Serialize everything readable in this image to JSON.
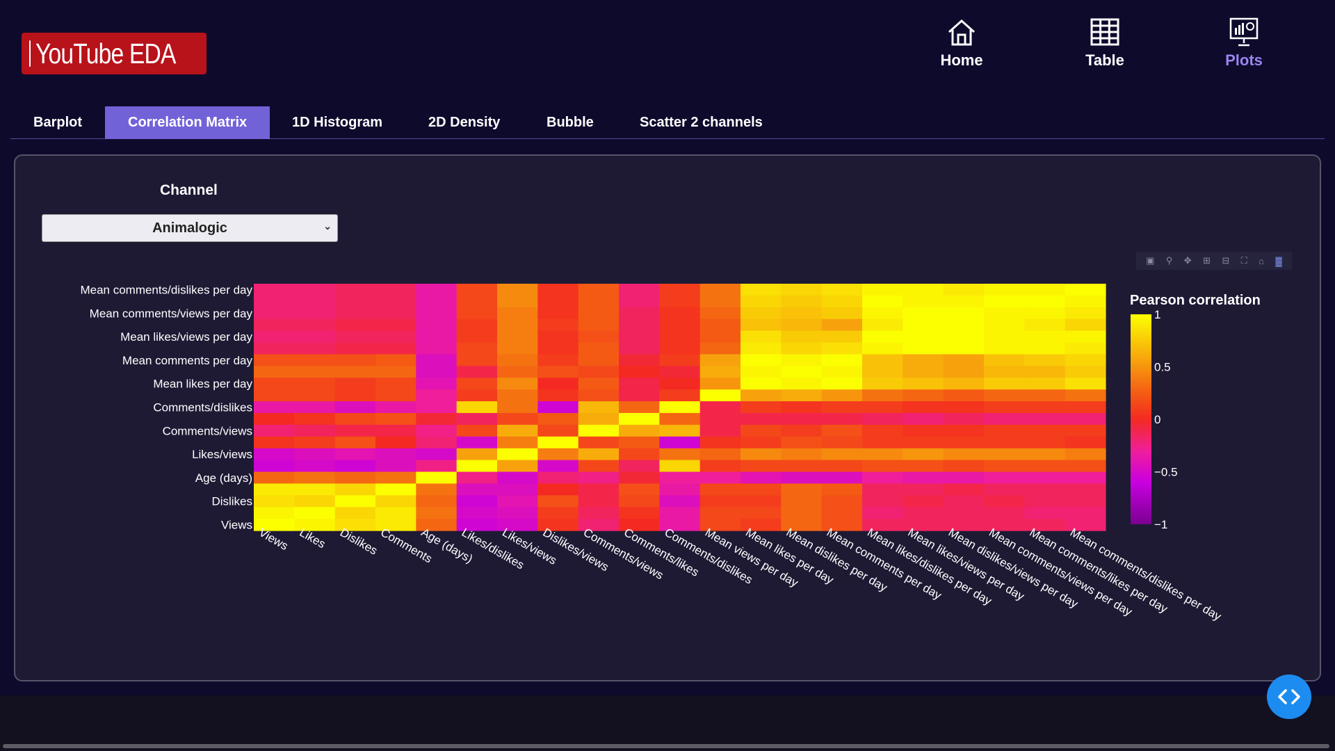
{
  "app": {
    "logo_text": "YouTube EDA"
  },
  "nav": {
    "items": [
      {
        "label": "Home",
        "icon": "home-icon",
        "color": "#ffffff"
      },
      {
        "label": "Table",
        "icon": "table-icon",
        "color": "#ffffff"
      },
      {
        "label": "Plots",
        "icon": "plots-icon",
        "color": "#9b84f0"
      }
    ]
  },
  "tabs": [
    {
      "label": "Barplot",
      "active": false
    },
    {
      "label": "Correlation Matrix",
      "active": true
    },
    {
      "label": "1D Histogram",
      "active": false
    },
    {
      "label": "2D Density",
      "active": false
    },
    {
      "label": "Bubble",
      "active": false
    },
    {
      "label": "Scatter 2 channels",
      "active": false
    }
  ],
  "filter": {
    "label": "Channel",
    "selected": "Animalogic"
  },
  "modebar": {
    "icons": [
      "camera-icon",
      "zoom-icon",
      "pan-icon",
      "zoom-in-icon",
      "zoom-out-icon",
      "autoscale-icon",
      "reset-axes-icon",
      "plotly-logo-icon"
    ]
  },
  "chart_data": {
    "type": "heatmap",
    "colorbar_title": "Pearson correlation",
    "colorscale": "plasma-like (purple-magenta-red-orange-yellow)",
    "zlim": [
      -1,
      1
    ],
    "colorbar_ticks": [
      "1",
      "0.5",
      "0",
      "−0.5",
      "−1"
    ],
    "colorbar_tick_values": [
      1,
      0.5,
      0,
      -0.5,
      -1
    ],
    "x_labels": [
      "Views",
      "Likes",
      "Dislikes",
      "Comments",
      "Age (days)",
      "Likes/dislikes",
      "Likes/views",
      "Dislikes/views",
      "Comments/views",
      "Comments/likes",
      "Comments/dislikes",
      "Mean views per day",
      "Mean likes per day",
      "Mean dislikes per day",
      "Mean comments per day",
      "Mean likes/dislikes per day",
      "Mean likes/views per day",
      "Mean dislikes/views per day",
      "Mean comments/views per day",
      "Mean comments/likes per day",
      "Mean comments/dislikes per day"
    ],
    "y_tick_labels": [
      "Mean comments/dislikes per day",
      "Mean comments/views per day",
      "Mean likes/views per day",
      "Mean comments per day",
      "Mean likes per day",
      "Comments/dislikes",
      "Comments/views",
      "Likes/views",
      "Age (days)",
      "Dislikes",
      "Views"
    ],
    "rows_top_to_bottom": [
      "Mean comments/dislikes per day",
      "Mean comments/likes per day",
      "Mean comments/views per day",
      "Mean dislikes/views per day",
      "Mean likes/views per day",
      "Mean likes/dislikes per day",
      "Mean comments per day",
      "Mean dislikes per day",
      "Mean likes per day",
      "Mean views per day",
      "Comments/dislikes",
      "Comments/likes",
      "Comments/views",
      "Dislikes/views",
      "Likes/views",
      "Likes/dislikes",
      "Age (days)",
      "Comments",
      "Dislikes",
      "Likes",
      "Views"
    ],
    "z_top_to_bottom": [
      [
        -0.2,
        -0.2,
        -0.15,
        -0.15,
        -0.35,
        0.15,
        0.45,
        0.05,
        0.25,
        -0.2,
        0.1,
        0.35,
        0.85,
        0.8,
        0.85,
        0.95,
        0.95,
        0.9,
        0.95,
        0.95,
        1.0
      ],
      [
        -0.2,
        -0.2,
        -0.15,
        -0.15,
        -0.35,
        0.15,
        0.45,
        0.05,
        0.25,
        -0.2,
        0.1,
        0.35,
        0.8,
        0.75,
        0.8,
        1.0,
        0.95,
        0.95,
        1.0,
        1.0,
        0.95
      ],
      [
        -0.2,
        -0.2,
        -0.15,
        -0.15,
        -0.35,
        0.15,
        0.4,
        0.05,
        0.25,
        -0.15,
        0.05,
        0.3,
        0.75,
        0.7,
        0.75,
        0.95,
        1.0,
        1.0,
        0.95,
        0.95,
        0.9
      ],
      [
        -0.15,
        -0.15,
        -0.1,
        -0.1,
        -0.35,
        0.1,
        0.4,
        0.1,
        0.25,
        -0.15,
        0.05,
        0.25,
        0.7,
        0.65,
        0.55,
        0.9,
        1.0,
        1.0,
        0.95,
        0.9,
        0.8
      ],
      [
        -0.2,
        -0.2,
        -0.15,
        -0.15,
        -0.35,
        0.1,
        0.4,
        0.05,
        0.2,
        -0.15,
        0.05,
        0.25,
        0.85,
        0.75,
        0.75,
        1.0,
        1.0,
        1.0,
        0.95,
        0.95,
        0.95
      ],
      [
        -0.15,
        -0.15,
        -0.1,
        -0.1,
        -0.35,
        0.15,
        0.4,
        0.05,
        0.25,
        -0.15,
        0.05,
        0.3,
        0.9,
        0.8,
        0.85,
        0.95,
        1.0,
        1.0,
        0.95,
        0.95,
        0.9
      ],
      [
        0.2,
        0.2,
        0.2,
        0.25,
        -0.45,
        0.15,
        0.35,
        0.1,
        0.25,
        -0.05,
        0.1,
        0.55,
        1.0,
        0.95,
        1.0,
        0.7,
        0.6,
        0.55,
        0.7,
        0.75,
        0.8
      ],
      [
        0.3,
        0.3,
        0.3,
        0.3,
        -0.45,
        -0.1,
        0.3,
        0.2,
        0.15,
        0.0,
        -0.05,
        0.6,
        0.95,
        1.0,
        0.95,
        0.7,
        0.6,
        0.55,
        0.65,
        0.65,
        0.75
      ],
      [
        0.15,
        0.15,
        0.1,
        0.15,
        -0.4,
        0.15,
        0.45,
        0.0,
        0.25,
        -0.1,
        0.0,
        0.5,
        1.0,
        0.95,
        1.0,
        0.75,
        0.7,
        0.65,
        0.75,
        0.75,
        0.85
      ],
      [
        0.15,
        0.15,
        0.1,
        0.15,
        -0.3,
        0.1,
        0.35,
        0.05,
        0.2,
        -0.1,
        0.1,
        1.0,
        0.55,
        0.6,
        0.5,
        0.35,
        0.3,
        0.25,
        0.3,
        0.3,
        0.35
      ],
      [
        -0.35,
        -0.35,
        -0.45,
        -0.35,
        -0.3,
        0.8,
        0.35,
        -0.55,
        0.65,
        0.3,
        1.0,
        -0.1,
        0.1,
        0.05,
        0.1,
        0.1,
        0.05,
        0.05,
        0.1,
        0.1,
        0.1
      ],
      [
        0.0,
        0.05,
        0.15,
        0.2,
        -0.05,
        -0.15,
        0.15,
        0.25,
        0.6,
        1.0,
        0.3,
        -0.1,
        -0.1,
        -0.1,
        -0.1,
        -0.15,
        -0.2,
        -0.15,
        -0.2,
        -0.2,
        -0.2
      ],
      [
        -0.2,
        -0.15,
        -0.1,
        -0.1,
        -0.25,
        0.15,
        0.6,
        0.15,
        1.0,
        0.6,
        0.65,
        -0.1,
        0.15,
        0.1,
        0.2,
        0.1,
        0.05,
        0.05,
        0.1,
        0.1,
        0.1
      ],
      [
        0.05,
        0.1,
        0.2,
        0.0,
        -0.2,
        -0.5,
        0.4,
        1.0,
        0.15,
        0.25,
        -0.55,
        0.05,
        0.1,
        0.2,
        0.15,
        0.1,
        0.1,
        0.1,
        0.1,
        0.1,
        0.05
      ],
      [
        -0.5,
        -0.45,
        -0.4,
        -0.45,
        -0.5,
        0.55,
        1.0,
        0.4,
        0.6,
        0.15,
        0.35,
        0.3,
        0.45,
        0.4,
        0.45,
        0.45,
        0.5,
        0.45,
        0.45,
        0.45,
        0.4
      ],
      [
        -0.55,
        -0.5,
        -0.55,
        -0.45,
        -0.25,
        1.0,
        0.55,
        -0.5,
        0.15,
        -0.15,
        0.8,
        0.1,
        0.15,
        0.15,
        0.15,
        0.2,
        0.2,
        0.15,
        0.2,
        0.2,
        0.2
      ],
      [
        0.3,
        0.35,
        0.3,
        0.35,
        1.0,
        -0.25,
        -0.5,
        -0.2,
        -0.25,
        -0.05,
        -0.3,
        -0.3,
        -0.4,
        -0.45,
        -0.45,
        -0.3,
        -0.35,
        -0.35,
        -0.3,
        -0.3,
        -0.3
      ],
      [
        0.9,
        0.9,
        0.8,
        1.0,
        0.35,
        -0.45,
        -0.45,
        0.0,
        -0.1,
        0.2,
        -0.35,
        0.15,
        0.15,
        0.3,
        0.25,
        -0.15,
        -0.15,
        -0.1,
        -0.15,
        -0.15,
        -0.15
      ],
      [
        0.85,
        0.8,
        1.0,
        0.8,
        0.3,
        -0.55,
        -0.4,
        0.2,
        -0.1,
        0.15,
        -0.45,
        0.1,
        0.1,
        0.3,
        0.2,
        -0.15,
        -0.1,
        -0.15,
        -0.1,
        -0.15,
        -0.15
      ],
      [
        0.95,
        1.0,
        0.8,
        0.9,
        0.35,
        -0.5,
        -0.45,
        0.1,
        -0.15,
        0.05,
        -0.35,
        0.15,
        0.15,
        0.3,
        0.2,
        -0.2,
        -0.15,
        -0.15,
        -0.15,
        -0.2,
        -0.2
      ],
      [
        1.0,
        0.95,
        0.85,
        0.9,
        0.3,
        -0.55,
        -0.5,
        0.05,
        -0.2,
        0.0,
        -0.35,
        0.15,
        0.1,
        0.3,
        0.2,
        -0.15,
        -0.15,
        -0.15,
        -0.15,
        -0.15,
        -0.2
      ]
    ]
  }
}
